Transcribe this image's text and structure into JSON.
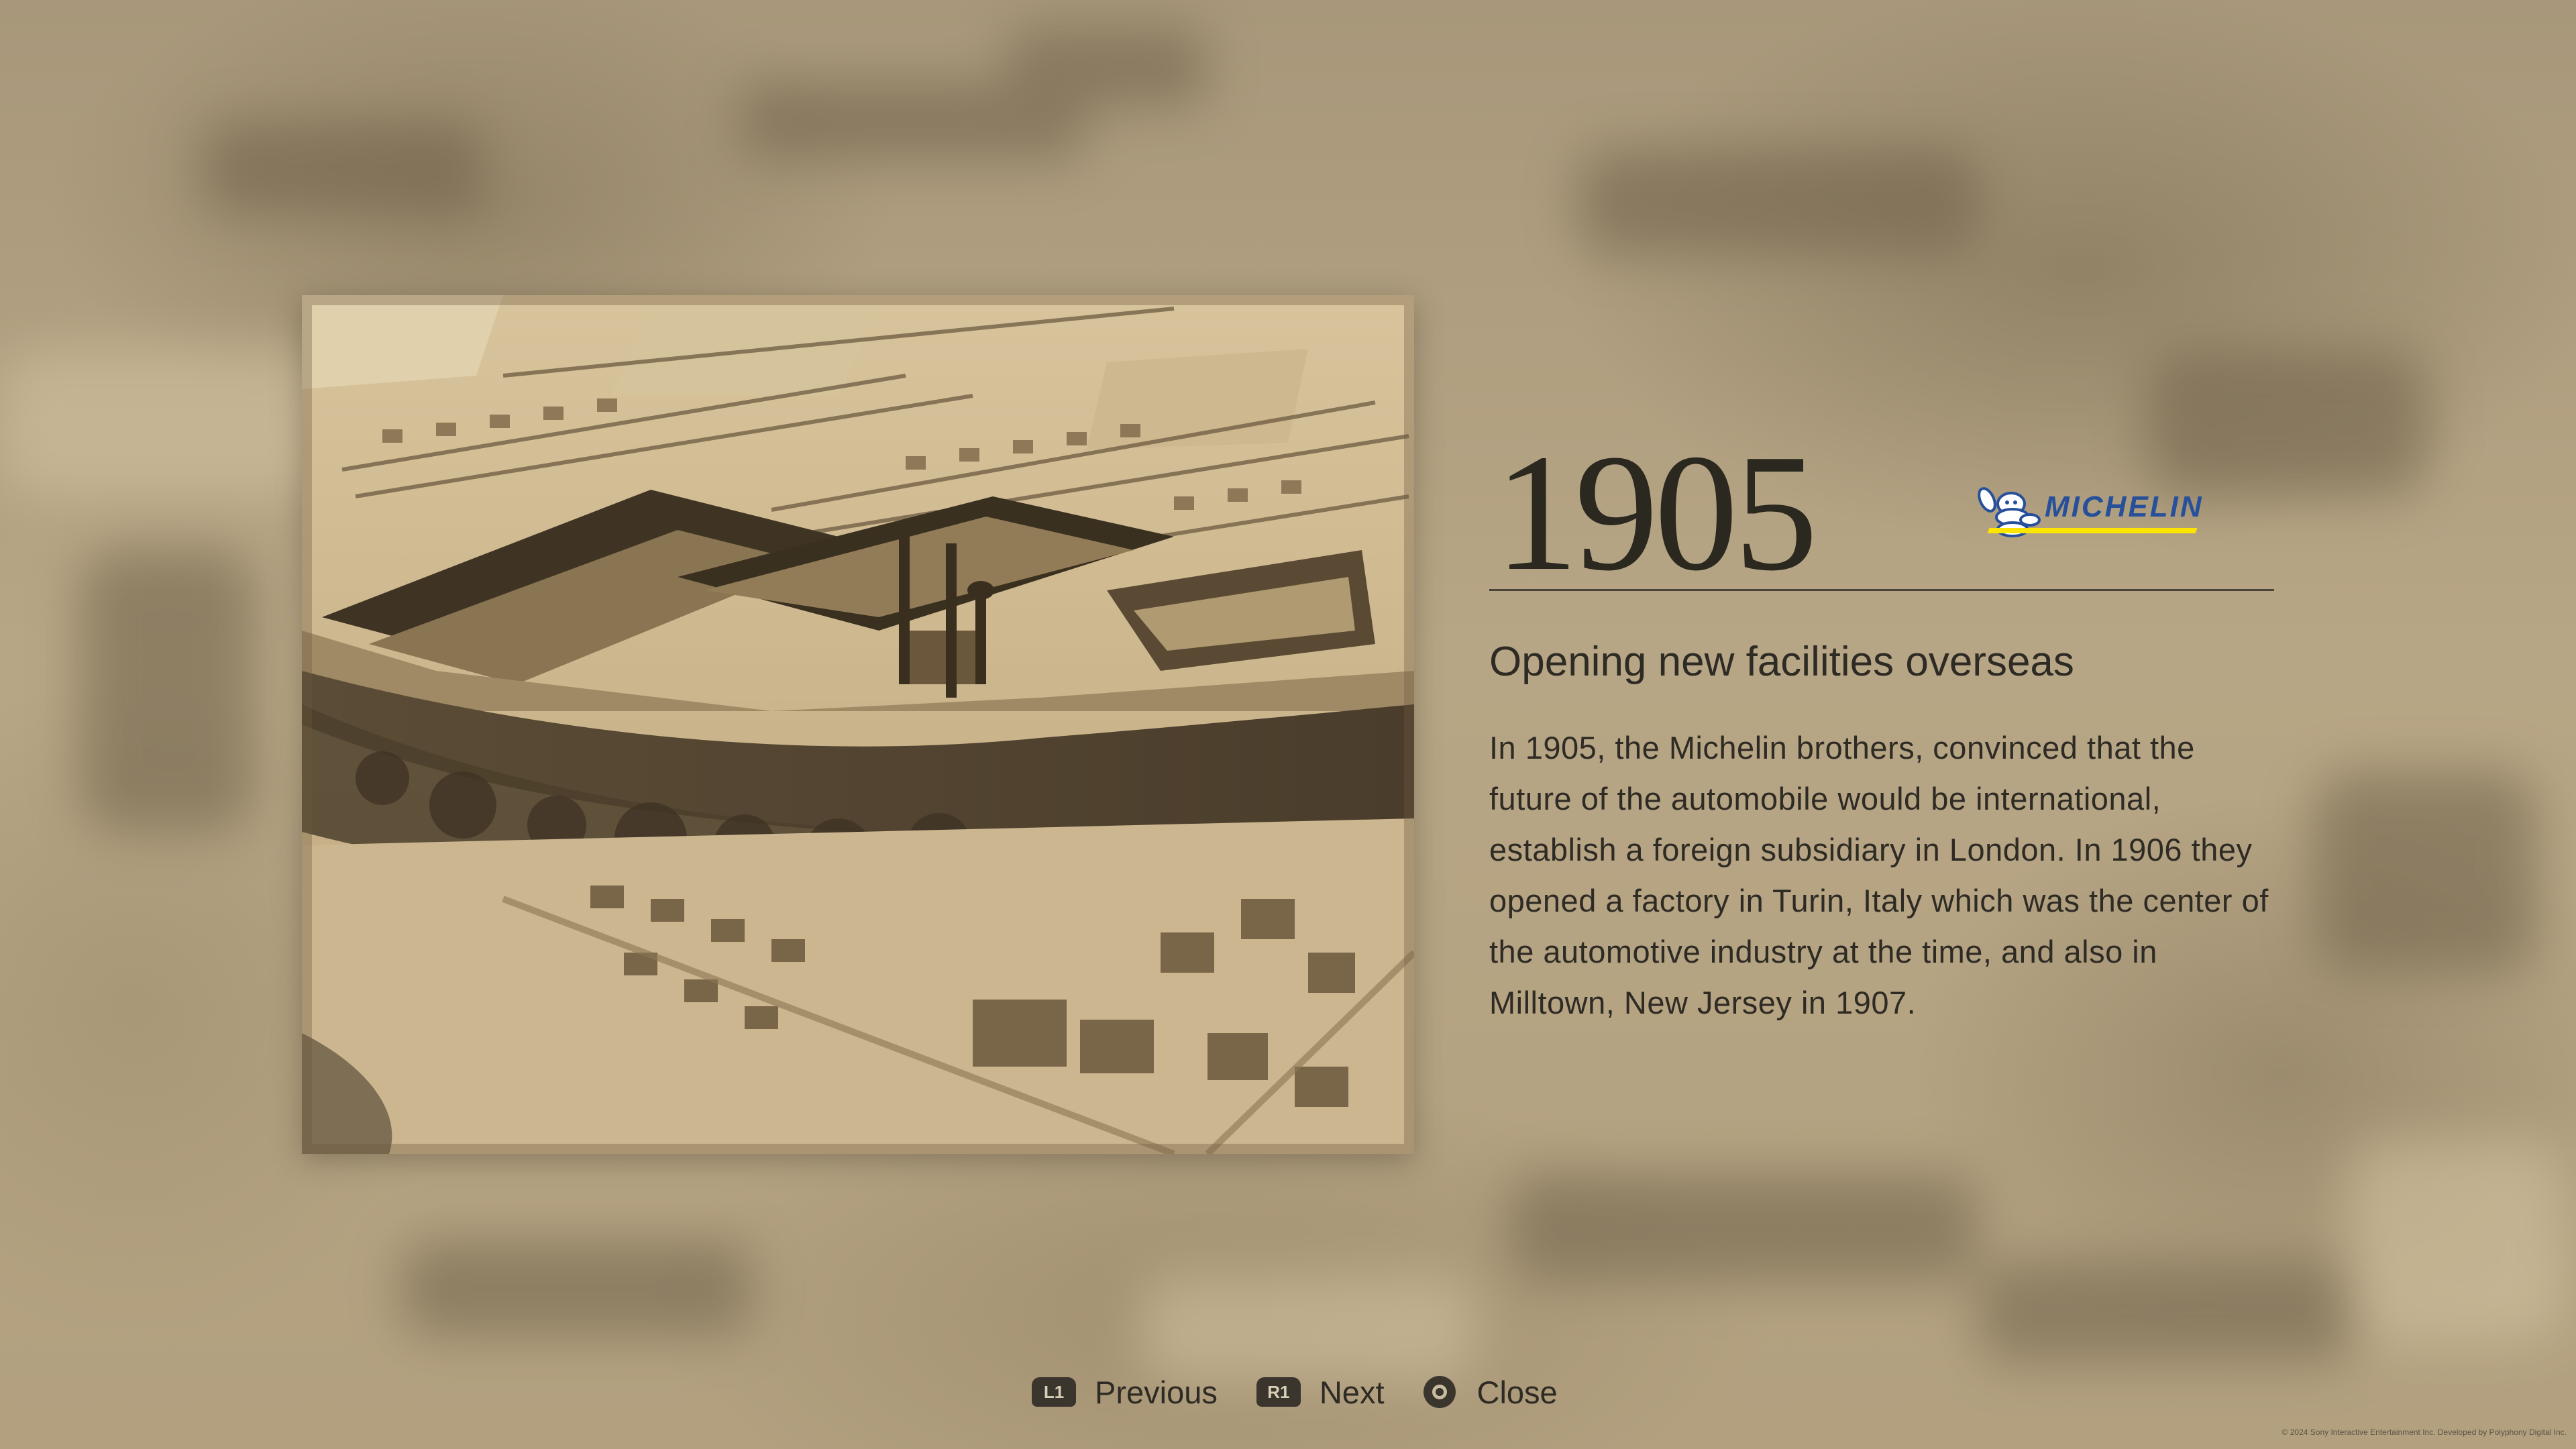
{
  "entry": {
    "year": "1905",
    "brand": "MICHELIN",
    "title": "Opening new facilities overseas",
    "body": "In 1905, the Michelin brothers, convinced that the future of the automobile would be international, establish a foreign subsidiary in London. In 1906 they opened a factory in Turin, Italy which was the center of the automotive industry at the time, and also in Milltown, New Jersey in 1907."
  },
  "photo": {
    "icon": "aerial-factory-photo"
  },
  "controls": {
    "previous": {
      "key": "L1",
      "label": "Previous"
    },
    "next": {
      "key": "R1",
      "label": "Next"
    },
    "close": {
      "icon": "circle-button-icon",
      "label": "Close"
    }
  },
  "footer": {
    "copyright": "© 2024 Sony Interactive Entertainment Inc. Developed by Polyphony Digital Inc."
  },
  "colors": {
    "background": "#b4a382",
    "text": "#2e2a24",
    "brand_blue": "#27509b",
    "brand_yellow": "#fce500"
  }
}
